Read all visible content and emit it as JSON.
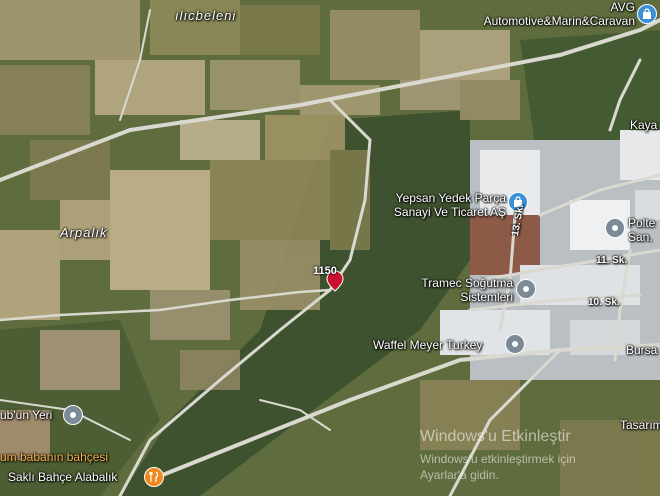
{
  "places": {
    "ilicbeleni": "ılıcbeleni",
    "arpalik": "Arpalık"
  },
  "pois": {
    "avg": "AVG\nAutomotive&Marin&Caravan",
    "yepsan": "Yepsan Yedek Parça\nSanayi Ve Ticaret AŞ",
    "tramec": "Tramec Soğutma\nSistemleri",
    "waffel": "Waffel Meyer Turkey",
    "poltek": "Polte\nSan.",
    "kaya": "Kaya",
    "babanin_yeri": "ub'un Yeri",
    "babanin_bahcesi": "um babanın bahçesi",
    "sakli_bahce": "Saklı Bahçe Alabalık",
    "bursa": "Bursa T",
    "tasarim": "Tasarım"
  },
  "roads": {
    "sk13": "13. Sk.",
    "sk11": "11. Sk.",
    "sk10": "10. Sk."
  },
  "marker": {
    "label": "1150",
    "color": "#c8102e"
  },
  "watermark": {
    "title": "Windows'u Etkinleştir",
    "subtitle": "Windows'u etkinleştirmek için",
    "subtitle2": "Ayarlar'a gidin."
  },
  "icons": {
    "gray_pin": "location-pin-icon",
    "blue_pin": "shopping-bag-icon",
    "orange_pin": "restaurant-icon"
  },
  "colors": {
    "poi_gray": "#7c8a96",
    "poi_blue": "#3d8fd8",
    "poi_orange": "#f08a1f"
  }
}
